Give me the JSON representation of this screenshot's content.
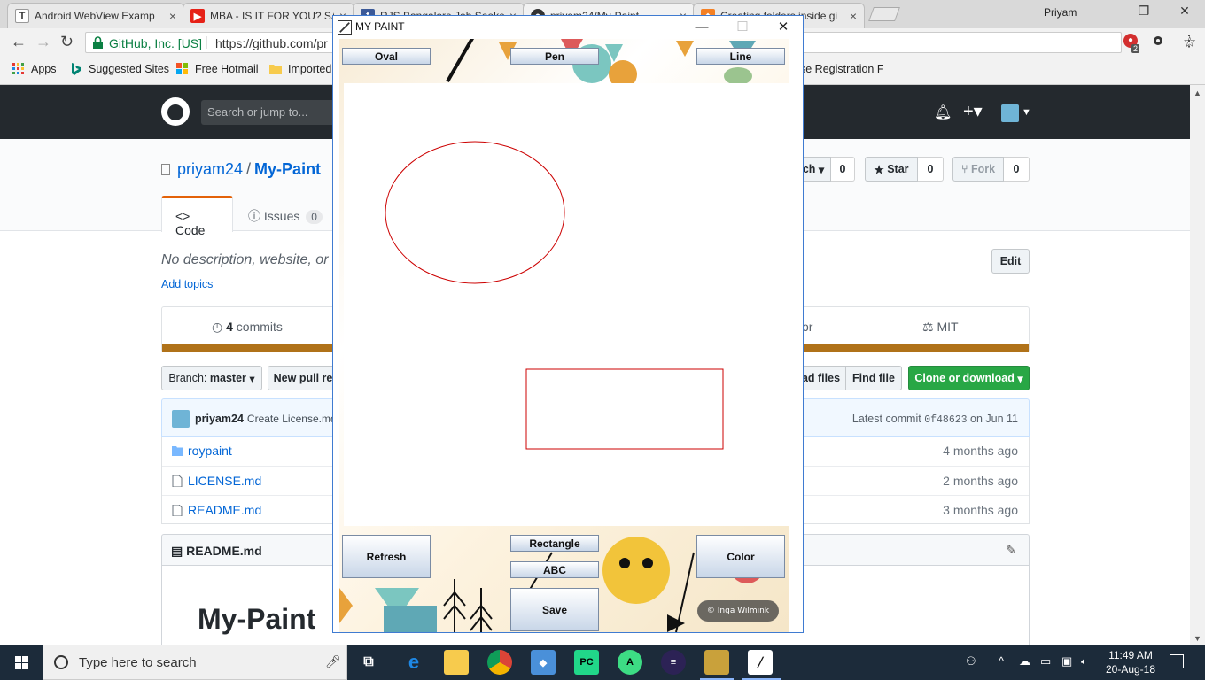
{
  "browser": {
    "tabs": [
      {
        "title": "Android WebView Examp",
        "favicon": "T",
        "color": "#333333"
      },
      {
        "title": "MBA - IS IT FOR YOU? SA",
        "favicon": "▶",
        "color": "#e62117"
      },
      {
        "title": "RJS Bangalore Job Seeke",
        "favicon": "f",
        "color": "#3b5998"
      },
      {
        "title": "priyam24/My-Paint",
        "favicon": "●",
        "color": "#333333"
      },
      {
        "title": "Creating folders inside gi",
        "favicon": "◆",
        "color": "#f48024"
      }
    ],
    "user_name": "Priyam",
    "secure_label": "GitHub, Inc. [US]",
    "url": "https://github.com/pr",
    "extension_badge": "2",
    "bookmarks": [
      "Apps",
      "Suggested Sites",
      "Free Hotmail",
      "Imported",
      "se Registration F"
    ]
  },
  "github": {
    "search_placeholder": "Search or jump to...",
    "owner": "priyam24",
    "repo": "My-Paint",
    "tab_code": "Code",
    "tab_issues": "Issues",
    "issues_count": "0",
    "watch_label": "ch",
    "watch_count": "0",
    "star_label": "Star",
    "star_count": "0",
    "fork_label": "Fork",
    "fork_count": "0",
    "description": "No description, website, or to",
    "add_topics": "Add topics",
    "edit_label": "Edit",
    "commits_count": "4",
    "commits_label": "commits",
    "contrib_fragment": "or",
    "license": "MIT",
    "branch_label": "Branch:",
    "branch_name": "master",
    "new_pr_label": "New pull re",
    "upload_label": "ad files",
    "find_file_label": "Find file",
    "clone_label": "Clone or download",
    "commit_author": "priyam24",
    "commit_message": "Create License.md",
    "latest_commit_label": "Latest commit",
    "commit_sha": "0f48623",
    "commit_date": "on Jun 11",
    "files": [
      {
        "name": "roypaint",
        "type": "folder",
        "age": "4 months ago"
      },
      {
        "name": "LICENSE.md",
        "type": "file",
        "age": "2 months ago"
      },
      {
        "name": "README.md",
        "type": "file",
        "age": "3 months ago"
      }
    ],
    "readme_title": "README.md",
    "readme_heading": "My-Paint",
    "language_color": "#b07219"
  },
  "paint": {
    "window_title": "MY PAINT",
    "buttons": {
      "oval": "Oval",
      "pen": "Pen",
      "line": "Line",
      "refresh": "Refresh",
      "rectangle": "Rectangle",
      "abc": "ABC",
      "color": "Color",
      "save": "Save"
    },
    "shape_color": "#cc0000",
    "credit": "© Inga Wilmink"
  },
  "taskbar": {
    "search_placeholder": "Type here to search",
    "time": "11:49 AM",
    "date": "20-Aug-18"
  }
}
